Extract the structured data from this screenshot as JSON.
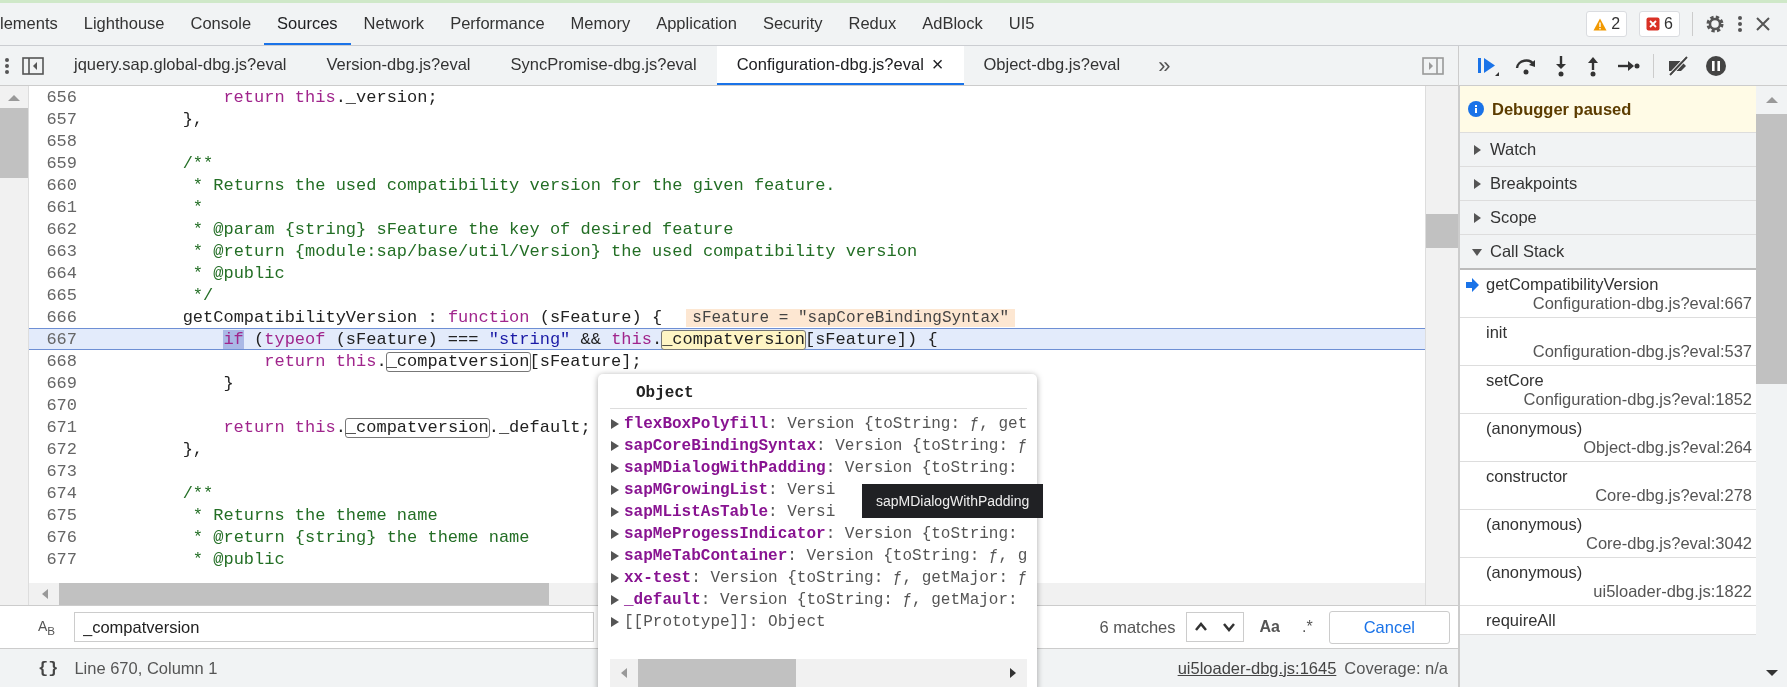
{
  "main_tabs": [
    {
      "label": "lements",
      "selected": false
    },
    {
      "label": "Lighthouse",
      "selected": false
    },
    {
      "label": "Console",
      "selected": false
    },
    {
      "label": "Sources",
      "selected": true
    },
    {
      "label": "Network",
      "selected": false
    },
    {
      "label": "Performance",
      "selected": false
    },
    {
      "label": "Memory",
      "selected": false
    },
    {
      "label": "Application",
      "selected": false
    },
    {
      "label": "Security",
      "selected": false
    },
    {
      "label": "Redux",
      "selected": false
    },
    {
      "label": "AdBlock",
      "selected": false
    },
    {
      "label": "UI5",
      "selected": false
    }
  ],
  "issue_counts": {
    "warnings": "2",
    "errors": "6"
  },
  "source_tabs": [
    {
      "label": "jquery.sap.global-dbg.js?eval",
      "selected": false
    },
    {
      "label": "Version-dbg.js?eval",
      "selected": false
    },
    {
      "label": "SyncPromise-dbg.js?eval",
      "selected": false
    },
    {
      "label": "Configuration-dbg.js?eval",
      "selected": true
    },
    {
      "label": "Object-dbg.js?eval",
      "selected": false
    }
  ],
  "tab_close": "×",
  "more_tabs": "»",
  "editor": {
    "lines": [
      {
        "number": "656",
        "current": false,
        "tokens": [
          {
            "text": "            return",
            "kind": "keyword"
          },
          {
            "text": " this",
            "kind": "keyword"
          },
          {
            "text": "._version;",
            "kind": "plain"
          }
        ]
      },
      {
        "number": "657",
        "current": false,
        "tokens": [
          {
            "text": "        },",
            "kind": "plain"
          }
        ]
      },
      {
        "number": "658",
        "current": false
      },
      {
        "number": "659",
        "current": false,
        "tokens": [
          {
            "text": "        /**",
            "kind": "comment"
          }
        ]
      },
      {
        "number": "660",
        "current": false,
        "tokens": [
          {
            "text": "         * Returns the used compatibility version for the given feature.",
            "kind": "comment"
          }
        ]
      },
      {
        "number": "661",
        "current": false,
        "tokens": [
          {
            "text": "         *",
            "kind": "comment"
          }
        ]
      },
      {
        "number": "662",
        "current": false,
        "tokens": [
          {
            "text": "         * @param {string} sFeature the key of desired feature",
            "kind": "comment"
          }
        ]
      },
      {
        "number": "663",
        "current": false,
        "tokens": [
          {
            "text": "         * @return {module:sap/base/util/Version} the used compatibility version",
            "kind": "comment"
          }
        ]
      },
      {
        "number": "664",
        "current": false,
        "tokens": [
          {
            "text": "         * @public",
            "kind": "comment"
          }
        ]
      },
      {
        "number": "665",
        "current": false,
        "tokens": [
          {
            "text": "         */",
            "kind": "comment"
          }
        ]
      },
      {
        "number": "666",
        "current": false,
        "tokens": [
          {
            "text": "        getCompatibilityVersion : ",
            "kind": "plain"
          },
          {
            "text": "function",
            "kind": "keyword"
          },
          {
            "text": " (sFeature) {",
            "kind": "plain"
          }
        ],
        "inline_value": "sFeature = \"sapCoreBindingSyntax\""
      },
      {
        "number": "667",
        "current": true,
        "tokens": [
          {
            "text": "            if",
            "kind": "exec"
          },
          {
            "text": " (",
            "kind": "plain"
          },
          {
            "text": "typeof",
            "kind": "keyword"
          },
          {
            "text": " (sFeature) === ",
            "kind": "plain"
          },
          {
            "text": "\"string\"",
            "kind": "string"
          },
          {
            "text": " && ",
            "kind": "plain"
          },
          {
            "text": "this",
            "kind": "keyword"
          },
          {
            "text": ".",
            "kind": "plain"
          },
          {
            "text": "_compatversion",
            "kind": "match_current"
          },
          {
            "text": "[sFeature]) {",
            "kind": "plain"
          }
        ]
      },
      {
        "number": "668",
        "current": false,
        "tokens": [
          {
            "text": "                return",
            "kind": "keyword"
          },
          {
            "text": " this",
            "kind": "keyword"
          },
          {
            "text": ".",
            "kind": "plain"
          },
          {
            "text": "_compatversion",
            "kind": "match"
          },
          {
            "text": "[sFeature];",
            "kind": "plain"
          }
        ]
      },
      {
        "number": "669",
        "current": false,
        "tokens": [
          {
            "text": "            }",
            "kind": "plain"
          }
        ]
      },
      {
        "number": "670",
        "current": false
      },
      {
        "number": "671",
        "current": false,
        "tokens": [
          {
            "text": "            return",
            "kind": "keyword"
          },
          {
            "text": " this",
            "kind": "keyword"
          },
          {
            "text": ".",
            "kind": "plain"
          },
          {
            "text": "_compatversion",
            "kind": "match"
          },
          {
            "text": "._default;",
            "kind": "plain"
          }
        ]
      },
      {
        "number": "672",
        "current": false,
        "tokens": [
          {
            "text": "        },",
            "kind": "plain"
          }
        ]
      },
      {
        "number": "673",
        "current": false
      },
      {
        "number": "674",
        "current": false,
        "tokens": [
          {
            "text": "        /**",
            "kind": "comment"
          }
        ]
      },
      {
        "number": "675",
        "current": false,
        "tokens": [
          {
            "text": "         * Returns the theme name",
            "kind": "comment"
          }
        ]
      },
      {
        "number": "676",
        "current": false,
        "tokens": [
          {
            "text": "         * @return {string} the theme name",
            "kind": "comment"
          }
        ]
      },
      {
        "number": "677",
        "current": false,
        "tokens": [
          {
            "text": "         * @public",
            "kind": "comment"
          }
        ]
      }
    ]
  },
  "popup": {
    "title": "Object",
    "properties": [
      {
        "key": "flexBoxPolyfill",
        "value": ": Version {toString: ƒ, get",
        "kind": "own"
      },
      {
        "key": "sapCoreBindingSyntax",
        "value": ": Version {toString: ƒ",
        "kind": "own"
      },
      {
        "key": "sapMDialogWithPadding",
        "value": ": Version {toString:",
        "kind": "own"
      },
      {
        "key": "sapMGrowingList",
        "value": ": Versi",
        "kind": "own"
      },
      {
        "key": "sapMListAsTable",
        "value": ": Versi",
        "kind": "own"
      },
      {
        "key": "sapMeProgessIndicator",
        "value": ": Version {toString:",
        "kind": "own"
      },
      {
        "key": "sapMeTabContainer",
        "value": ": Version {toString: ƒ, g",
        "kind": "own"
      },
      {
        "key": "xx-test",
        "value": ": Version {toString: ƒ, getMajor: ƒ",
        "kind": "own"
      },
      {
        "key": "_default",
        "value": ": Version {toString: ƒ, getMajor:",
        "kind": "own"
      },
      {
        "key": "[[Prototype]]",
        "value": ": Object",
        "kind": "internal"
      }
    ],
    "tooltip": "sapMDialogWithPadding"
  },
  "search": {
    "replace_toggle": "A$_{B}$",
    "value": "_compatversion",
    "matches": "6 matches",
    "case_label": "Aa",
    "regex_label": ".*",
    "cancel": "Cancel"
  },
  "status_bar": {
    "format": "{}",
    "position": "Line 670, Column 1",
    "link": "ui5loader-dbg.js:1645",
    "coverage": "Coverage: n/a"
  },
  "debugger": {
    "banner": "Debugger paused",
    "sections": [
      {
        "label": "Watch",
        "expanded": false
      },
      {
        "label": "Breakpoints",
        "expanded": false
      },
      {
        "label": "Scope",
        "expanded": false
      },
      {
        "label": "Call Stack",
        "expanded": true
      }
    ],
    "call_stack": [
      {
        "name": "getCompatibilityVersion",
        "location": "Configuration-dbg.js?eval:667",
        "selected": true
      },
      {
        "name": "init",
        "location": "Configuration-dbg.js?eval:537",
        "selected": false
      },
      {
        "name": "setCore",
        "location": "Configuration-dbg.js?eval:1852",
        "selected": false
      },
      {
        "name": "(anonymous)",
        "location": "Object-dbg.js?eval:264",
        "selected": false
      },
      {
        "name": "constructor",
        "location": "Core-dbg.js?eval:278",
        "selected": false
      },
      {
        "name": "(anonymous)",
        "location": "Core-dbg.js?eval:3042",
        "selected": false
      },
      {
        "name": "(anonymous)",
        "location": "ui5loader-dbg.js:1822",
        "selected": false
      },
      {
        "name": "requireAll",
        "selected": false
      }
    ]
  }
}
